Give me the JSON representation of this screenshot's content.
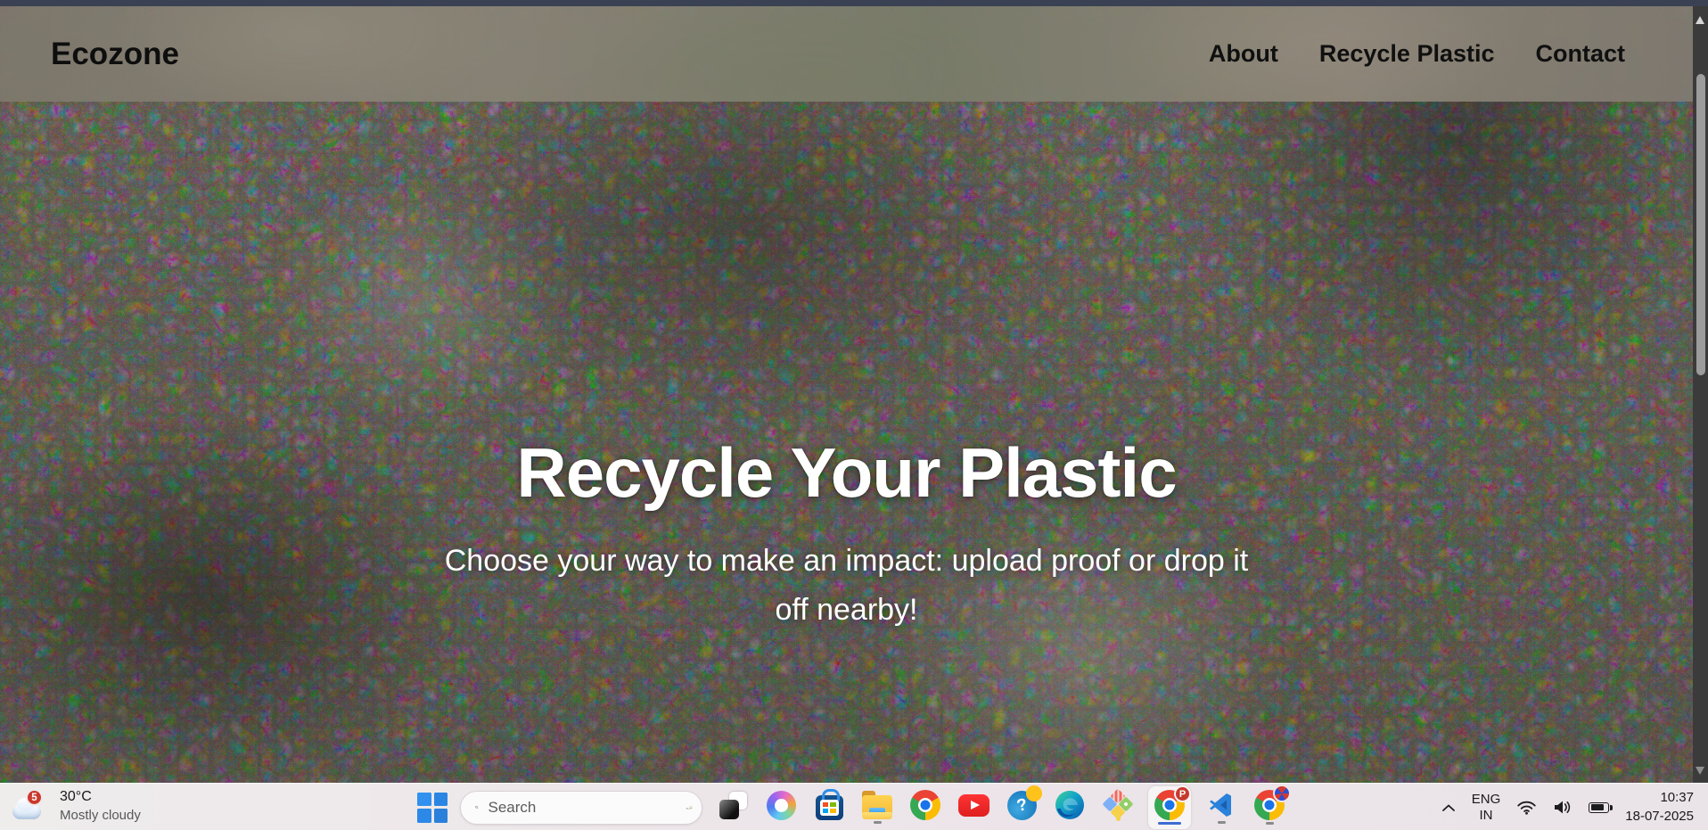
{
  "site": {
    "brand": "Ecozone",
    "nav": [
      {
        "label": "About"
      },
      {
        "label": "Recycle Plastic"
      },
      {
        "label": "Contact"
      }
    ],
    "hero": {
      "title": "Recycle Your Plastic",
      "subtitle_lines": [
        "Choose your way to make an impact: upload proof or drop it",
        "off nearby!"
      ],
      "background_description": "Aerial photo of a landfill covered in mixed colorful plastic waste"
    }
  },
  "taskbar": {
    "weather": {
      "alert_count": "5",
      "temperature": "30°C",
      "condition": "Mostly cloudy"
    },
    "search": {
      "placeholder": "Search"
    },
    "apps": [
      {
        "name": "Task View",
        "icon": "task-view-icon",
        "running": false,
        "active": false
      },
      {
        "name": "Copilot",
        "icon": "copilot-icon",
        "running": false,
        "active": false
      },
      {
        "name": "Microsoft Store",
        "icon": "microsoft-store-icon",
        "running": false,
        "active": false
      },
      {
        "name": "File Explorer",
        "icon": "file-explorer-icon",
        "running": true,
        "active": false
      },
      {
        "name": "Google Chrome",
        "icon": "chrome-icon",
        "running": false,
        "active": false
      },
      {
        "name": "YouTube",
        "icon": "youtube-icon",
        "running": false,
        "active": false
      },
      {
        "name": "Help",
        "icon": "question-mark-app-icon",
        "glyph": "?",
        "running": false,
        "active": false
      },
      {
        "name": "Microsoft Edge",
        "icon": "edge-icon",
        "running": false,
        "active": false
      },
      {
        "name": "Paint diamond app",
        "icon": "paint-diamond-icon",
        "running": false,
        "active": false
      },
      {
        "name": "Google Chrome - profile P",
        "icon": "chrome-profile-p-icon",
        "badge": "P",
        "running": true,
        "active": true
      },
      {
        "name": "Visual Studio Code",
        "icon": "vscode-icon",
        "running": true,
        "active": false
      },
      {
        "name": "Google Chrome - profile 2",
        "icon": "chrome-profile-2-icon",
        "running": true,
        "active": false
      }
    ],
    "tray": {
      "language": "ENG",
      "region": "IN",
      "time": "10:37",
      "date": "18-07-2025"
    }
  },
  "colors": {
    "window_top_bar": "#3a4153",
    "taskbar": "#ece6e9",
    "active_indicator_blue": "#3e6cd1",
    "weather_badge_red": "#ca392c"
  }
}
